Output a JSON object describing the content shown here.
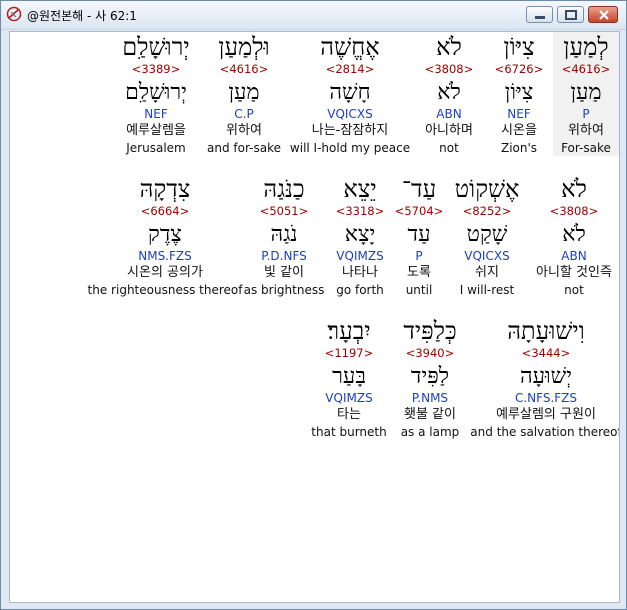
{
  "window": {
    "title": "@원전본해 - 사 62:1"
  },
  "rows": [
    {
      "words": [
        {
          "heb": "לְמַעַן",
          "strong": "<4616>",
          "lemma": "מַעַן",
          "morph": "P",
          "kor": "위하여",
          "eng": "For-sake",
          "selected": true,
          "w": 66
        },
        {
          "heb": "צִיּוֹן",
          "strong": "<6726>",
          "lemma": "צִיּוֹן",
          "morph": "NEF",
          "kor": "시온을",
          "eng": "Zion's",
          "selected": false,
          "w": 68
        },
        {
          "heb": "לֹא",
          "strong": "<3808>",
          "lemma": "לֹא",
          "morph": "ABN",
          "kor": "아니하며",
          "eng": "not",
          "selected": false,
          "w": 72
        },
        {
          "heb": "אֶחֱשֶׁה",
          "strong": "<2814>",
          "lemma": "חָשָׁה",
          "morph": "VQICXS",
          "kor": "나는-잠잠하지",
          "eng": "will I-hold my peace",
          "selected": false,
          "w": 126
        },
        {
          "heb": "וּלְמַעַן",
          "strong": "<4616>",
          "lemma": "מַעַן",
          "morph": "C.P",
          "kor": "위하여",
          "eng": "and for-sake",
          "selected": false,
          "w": 86
        },
        {
          "heb": "יְרוּשָׁלִַם",
          "strong": "<3389>",
          "lemma": "יְרוּשָׁלִַם",
          "morph": "NEF",
          "kor": "예루살렘을",
          "eng": "Jerusalem",
          "selected": false,
          "w": 90
        }
      ]
    },
    {
      "words": [
        {
          "heb": "לֹא",
          "strong": "<3808>",
          "lemma": "לֹא",
          "morph": "ABN",
          "kor": "아니할 것인즉",
          "eng": "not",
          "selected": false,
          "w": 90
        },
        {
          "heb": "אֶשְׁקוֹט",
          "strong": "<8252>",
          "lemma": "שָׁקַט",
          "morph": "VQICXS",
          "kor": "쉬지",
          "eng": "I will-rest",
          "selected": false,
          "w": 84
        },
        {
          "heb": "עַד־",
          "strong": "<5704>",
          "lemma": "עַד",
          "morph": "P",
          "kor": "도록",
          "eng": "until",
          "selected": false,
          "w": 52
        },
        {
          "heb": "יֵצֵא",
          "strong": "<3318>",
          "lemma": "יָצָא",
          "morph": "VQIMZS",
          "kor": "나타나",
          "eng": "go forth",
          "selected": false,
          "w": 66
        },
        {
          "heb": "כַנֹּגַהּ",
          "strong": "<5051>",
          "lemma": "נֹגַהּ",
          "morph": "P.D.NFS",
          "kor": "빛 같이",
          "eng": "as brightness",
          "selected": false,
          "w": 86
        },
        {
          "heb": "צִדְקָהּ",
          "strong": "<6664>",
          "lemma": "צֶדֶק",
          "morph": "NMS.FZS",
          "kor": "시온의 공의가",
          "eng": "the righteousness thereof",
          "selected": false,
          "w": 152
        }
      ]
    },
    {
      "words": [
        {
          "heb": "וִישׁוּעָתָהּ",
          "strong": "<3444>",
          "lemma": "יְשׁוּעָה",
          "morph": "C.NFS.FZS",
          "kor": "예루살렘의 구원이",
          "eng": "and the salvation thereof",
          "selected": false,
          "w": 146
        },
        {
          "heb": "כְּלַפִּיד",
          "strong": "<3940>",
          "lemma": "לַפִּיד",
          "morph": "P.NMS",
          "kor": "횃불 같이",
          "eng": "as a lamp",
          "selected": false,
          "w": 86
        },
        {
          "heb": "יִבְעָר׃",
          "strong": "<1197>",
          "lemma": "בָּעַר",
          "morph": "VQIMZS",
          "kor": "타는",
          "eng": "that burneth",
          "selected": false,
          "w": 76
        }
      ]
    }
  ]
}
